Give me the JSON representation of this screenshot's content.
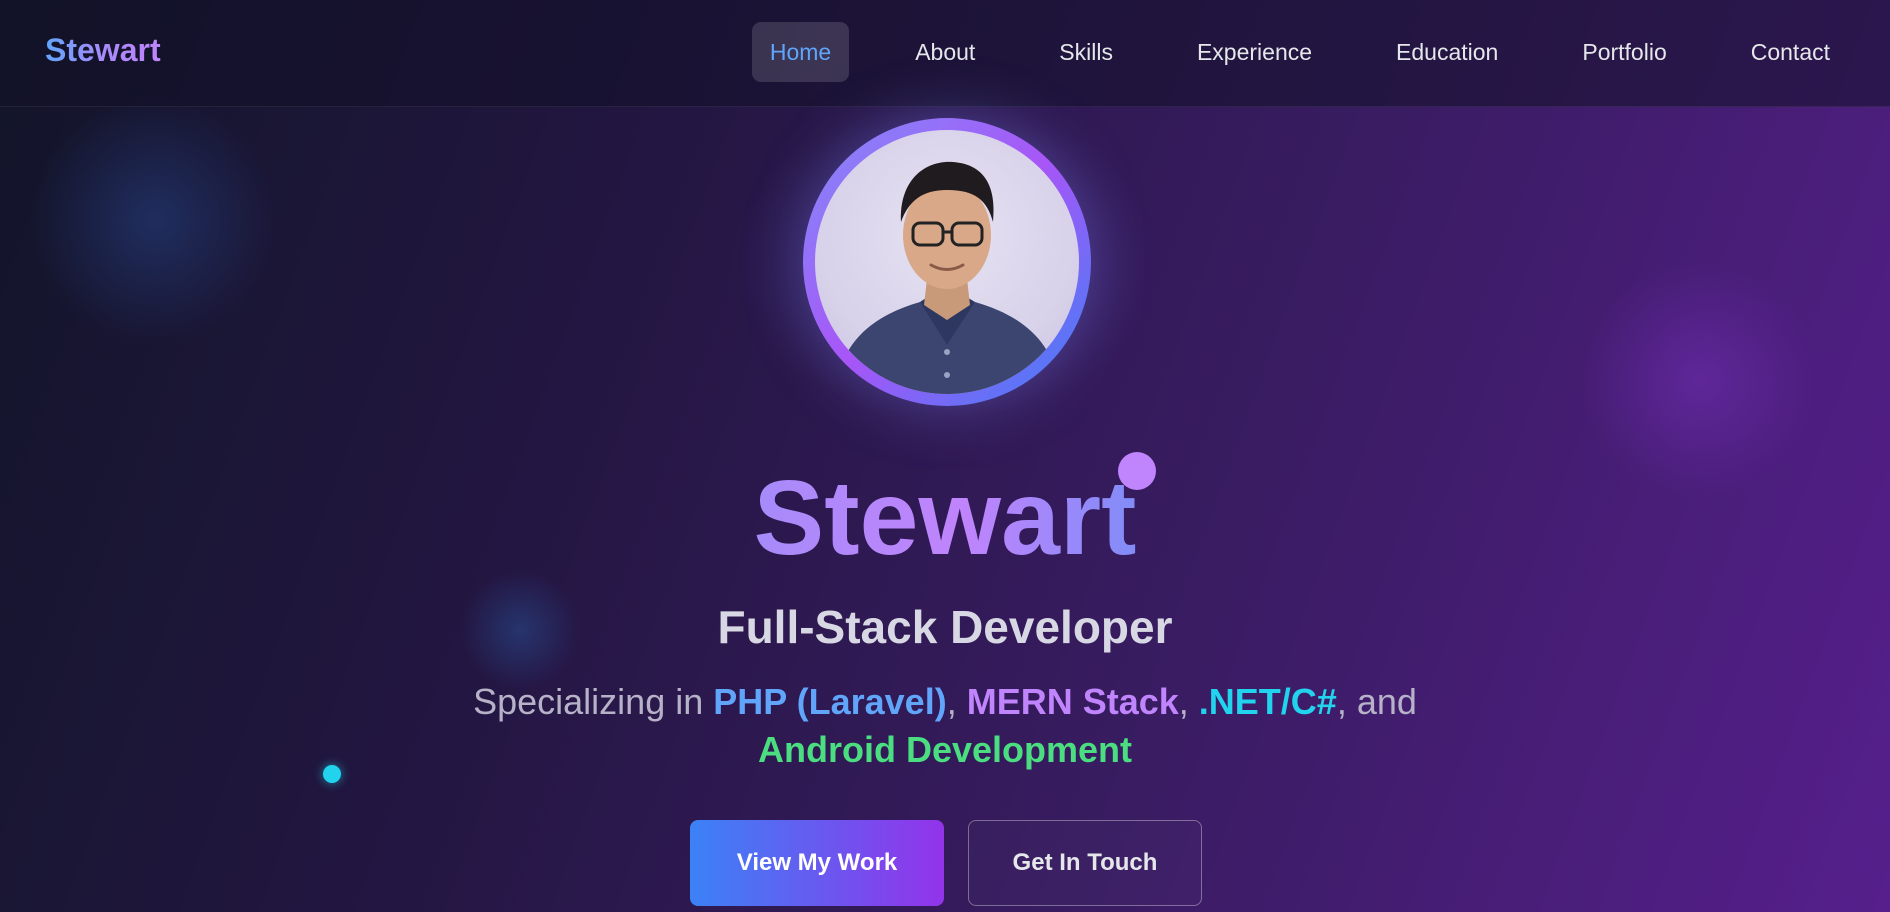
{
  "header": {
    "brand": "Stewart",
    "nav": [
      {
        "label": "Home",
        "active": true
      },
      {
        "label": "About"
      },
      {
        "label": "Skills"
      },
      {
        "label": "Experience"
      },
      {
        "label": "Education"
      },
      {
        "label": "Portfolio"
      },
      {
        "label": "Contact"
      }
    ]
  },
  "hero": {
    "name": "Stewart",
    "role": "Full-Stack Developer",
    "spec": {
      "prefix": "Specializing in ",
      "skill1": "PHP (Laravel)",
      "sep1": ", ",
      "skill2": "MERN Stack",
      "sep2": ", ",
      "skill3": ".NET/C#",
      "sep3": ", and ",
      "skill4": "Android Development"
    },
    "buttons": {
      "primary": "View My Work",
      "secondary": "Get In Touch"
    }
  },
  "colors": {
    "accent_blue": "#60a5fa",
    "accent_purple": "#c084fc",
    "accent_cyan": "#22d3ee",
    "accent_green": "#4ade80"
  }
}
